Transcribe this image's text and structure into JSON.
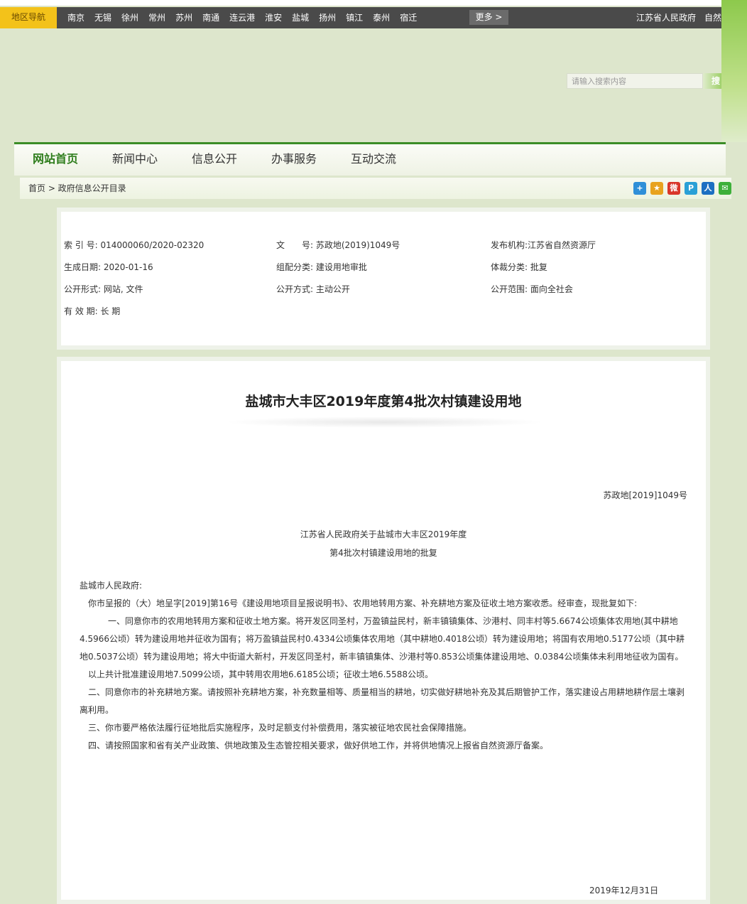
{
  "topbar": {
    "region_label": "地区导航",
    "cities": [
      "南京",
      "无锡",
      "徐州",
      "常州",
      "苏州",
      "南通",
      "连云港",
      "淮安",
      "盐城",
      "扬州",
      "镇江",
      "泰州",
      "宿迁"
    ],
    "more_label": "更多 >",
    "gov_link": "江苏省人民政府　自然"
  },
  "search": {
    "placeholder": "请输入搜索内容",
    "button": "搜"
  },
  "nav": {
    "items": [
      "网站首页",
      "新闻中心",
      "信息公开",
      "办事服务",
      "互动交流"
    ]
  },
  "breadcrumb": {
    "text": "首页 > 政府信息公开目录"
  },
  "share": [
    {
      "icon": "plus-icon",
      "glyph": "+",
      "color": "#2f8fd8"
    },
    {
      "icon": "qzone-icon",
      "glyph": "★",
      "color": "#e8a21e"
    },
    {
      "icon": "weibo-icon",
      "glyph": "微",
      "color": "#d9362a"
    },
    {
      "icon": "tencent-weibo-icon",
      "glyph": "P",
      "color": "#2aa0d6"
    },
    {
      "icon": "renren-icon",
      "glyph": "人",
      "color": "#1d6fc2"
    },
    {
      "icon": "wechat-icon",
      "glyph": "✉",
      "color": "#3eb03a"
    }
  ],
  "meta": {
    "index_no": "索 引 号: 014000060/2020-02320",
    "doc_no": "文　　号: 苏政地(2019)1049号",
    "publisher": "发布机构:江苏省自然资源厅",
    "gen_date": "生成日期: 2020-01-16",
    "category": "组配分类: 建设用地审批",
    "genre": "体裁分类: 批复",
    "open_form": "公开形式: 网站, 文件",
    "open_method": "公开方式: 主动公开",
    "open_scope": "公开范围: 面向全社会",
    "validity": "有 效 期: 长 期"
  },
  "doc": {
    "title": "盐城市大丰区2019年度第4批次村镇建设用地",
    "number": "苏政地[2019]1049号",
    "subtitle_1": "江苏省人民政府关于盐城市大丰区2019年度",
    "subtitle_2": "第4批次村镇建设用地的批复",
    "salutation": "盐城市人民政府:",
    "p1": "你市呈报的（大）地呈字[2019]第16号《建设用地项目呈报说明书》、农用地转用方案、补充耕地方案及征收土地方案收悉。经审查，现批复如下:",
    "p2": "一、同意你市的农用地转用方案和征收土地方案。将开发区同圣村，万盈镇益民村，新丰镇镇集体、沙港村、同丰村等5.6674公顷集体农用地(其中耕地4.5966公顷）转为建设用地并征收为国有；将万盈镇益民村0.4334公顷集体农用地（其中耕地0.4018公顷）转为建设用地；将国有农用地0.5177公顷（其中耕地0.5037公顷）转为建设用地；将大中街道大新村，开发区同圣村，新丰镇镇集体、沙港村等0.853公顷集体建设用地、0.0384公顷集体未利用地征收为国有。",
    "p3": "以上共计批准建设用地7.5099公顷，其中转用农用地6.6185公顷；征收土地6.5588公顷。",
    "p4": "二、同意你市的补充耕地方案。请按照补充耕地方案，补充数量相等、质量相当的耕地，切实做好耕地补充及其后期管护工作，落实建设占用耕地耕作层土壤剥离利用。",
    "p5": "三、你市要严格依法履行征地批后实施程序，及时足额支付补偿费用，落实被征地农民社会保障措施。",
    "p6": "四、请按照国家和省有关产业政策、供地政策及生态管控相关要求，做好供地工作，并将供地情况上报省自然资源厅备案。",
    "date": "2019年12月31日"
  }
}
